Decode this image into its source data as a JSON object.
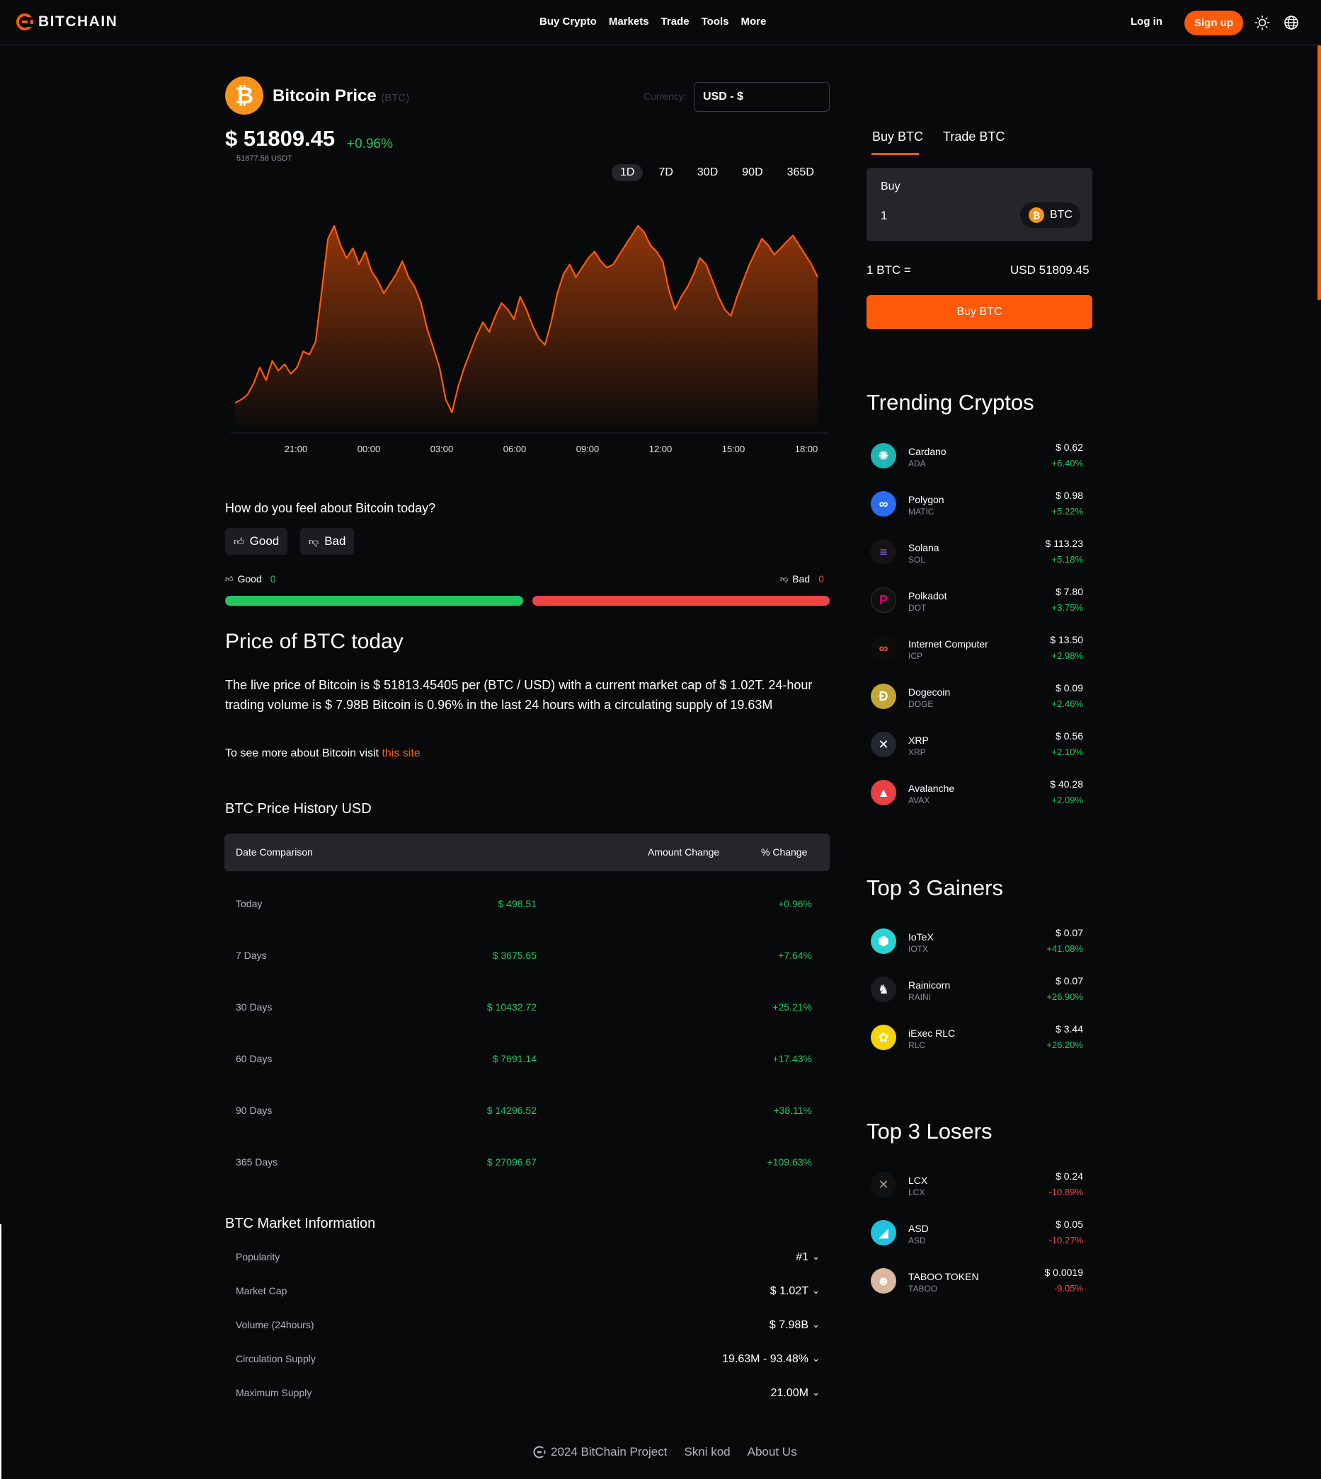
{
  "header": {
    "brand": "BITCHAIN",
    "nav": [
      "Buy Crypto",
      "Markets",
      "Trade",
      "Tools",
      "More"
    ],
    "login": "Log in",
    "signup": "Sign up"
  },
  "coin": {
    "name": "Bitcoin Price",
    "symbol_tag": "(BTC)",
    "currency_label": "Currency:",
    "currency_value": "USD - $",
    "price": "$ 51809.45",
    "change": "+0.96%",
    "price_usdt": "51877.58 USDT",
    "ranges": [
      "1D",
      "7D",
      "30D",
      "90D",
      "365D"
    ],
    "active_range": "1D"
  },
  "chart_data": {
    "type": "area",
    "x_ticks": [
      "21:00",
      "00:00",
      "03:00",
      "06:00",
      "09:00",
      "12:00",
      "15:00",
      "18:00"
    ],
    "series": [
      {
        "values": [
          50950,
          50960,
          50975,
          51010,
          51060,
          51020,
          51080,
          51050,
          51070,
          51040,
          51060,
          51110,
          51100,
          51140,
          51300,
          51460,
          51500,
          51440,
          51400,
          51430,
          51380,
          51420,
          51360,
          51330,
          51290,
          51320,
          51350,
          51390,
          51340,
          51310,
          51260,
          51180,
          51120,
          51060,
          50960,
          50920,
          51000,
          51060,
          51110,
          51160,
          51200,
          51170,
          51220,
          51260,
          51240,
          51210,
          51280,
          51240,
          51190,
          51150,
          51130,
          51200,
          51290,
          51350,
          51380,
          51340,
          51370,
          51400,
          51420,
          51390,
          51370,
          51380,
          51410,
          51440,
          51470,
          51500,
          51480,
          51440,
          51420,
          51390,
          51300,
          51240,
          51280,
          51310,
          51350,
          51400,
          51380,
          51330,
          51280,
          51240,
          51220,
          51280,
          51330,
          51380,
          51420,
          51460,
          51440,
          51410,
          51430,
          51450,
          51470,
          51440,
          51410,
          51380,
          51340
        ]
      }
    ],
    "ylim": [
      50900,
      51520
    ]
  },
  "sentiment": {
    "question": "How do you feel about Bitcoin today?",
    "good_label": "Good",
    "bad_label": "Bad",
    "good_count": "0",
    "bad_count": "0"
  },
  "about": {
    "heading": "Price of BTC today",
    "paragraph": "The live price of Bitcoin is $ 51813.45405 per (BTC / USD) with a current market cap of $ 1.02T. 24-hour trading volume is $ 7.98B Bitcoin is 0.96% in the last 24 hours with a circulating supply of 19.63M",
    "more_prefix": "To see more about Bitcoin visit",
    "more_link": "this site"
  },
  "history": {
    "heading": "BTC Price History USD",
    "columns": [
      "Date Comparison",
      "Amount Change",
      "% Change"
    ],
    "rows": [
      {
        "label": "Today",
        "amount": "$ 498.51",
        "pct": "+0.96%"
      },
      {
        "label": "7 Days",
        "amount": "$ 3675.65",
        "pct": "+7.64%"
      },
      {
        "label": "30 Days",
        "amount": "$ 10432.72",
        "pct": "+25.21%"
      },
      {
        "label": "60 Days",
        "amount": "$ 7691.14",
        "pct": "+17.43%"
      },
      {
        "label": "90 Days",
        "amount": "$ 14296.52",
        "pct": "+38.11%"
      },
      {
        "label": "365 Days",
        "amount": "$ 27096.67",
        "pct": "+109.63%"
      }
    ]
  },
  "market": {
    "heading": "BTC Market Information",
    "rows": [
      {
        "label": "Popularity",
        "value": "#1"
      },
      {
        "label": "Market Cap",
        "value": "$ 1.02T"
      },
      {
        "label": "Volume (24hours)",
        "value": "$ 7.98B"
      },
      {
        "label": "Circulation Supply",
        "value": "19.63M - 93.48%"
      },
      {
        "label": "Maximum Supply",
        "value": "21.00M"
      }
    ]
  },
  "footer": {
    "copyright": "2024 BitChain Project",
    "link1": "Skni kod",
    "link2": "About Us"
  },
  "trade": {
    "tabs": [
      "Buy BTC",
      "Trade BTC"
    ],
    "buy_label": "Buy",
    "amount": "1",
    "token": "BTC",
    "rate_left": "1 BTC =",
    "rate_right": "USD 51809.45",
    "button": "Buy BTC"
  },
  "trending": {
    "heading": "Trending Cryptos",
    "items": [
      {
        "name": "Cardano",
        "symbol": "ADA",
        "price": "$ 0.62",
        "change": "+6.40%",
        "icon": "cardano-icon",
        "color": "#1fb5b5"
      },
      {
        "name": "Polygon",
        "symbol": "MATIC",
        "price": "$ 0.98",
        "change": "+5.22%",
        "icon": "polygon-icon",
        "color": "#2b6def"
      },
      {
        "name": "Solana",
        "symbol": "SOL",
        "price": "$ 113.23",
        "change": "+5.18%",
        "icon": "solana-icon",
        "color": "#141414"
      },
      {
        "name": "Polkadot",
        "symbol": "DOT",
        "price": "$ 7.80",
        "change": "+3.75%",
        "icon": "polkadot-icon",
        "color": "#111111"
      },
      {
        "name": "Internet Computer",
        "symbol": "ICP",
        "price": "$ 13.50",
        "change": "+2.98%",
        "icon": "icp-icon",
        "color": "#111111"
      },
      {
        "name": "Dogecoin",
        "symbol": "DOGE",
        "price": "$ 0.09",
        "change": "+2.46%",
        "icon": "dogecoin-icon",
        "color": "#c2a633"
      },
      {
        "name": "XRP",
        "symbol": "XRP",
        "price": "$ 0.56",
        "change": "+2.10%",
        "icon": "xrp-icon",
        "color": "#23272e"
      },
      {
        "name": "Avalanche",
        "symbol": "AVAX",
        "price": "$ 40.28",
        "change": "+2.09%",
        "icon": "avalanche-icon",
        "color": "#e84142"
      }
    ]
  },
  "gainers": {
    "heading": "Top 3 Gainers",
    "items": [
      {
        "name": "IoTeX",
        "symbol": "IOTX",
        "price": "$ 0.07",
        "change": "+41.08%",
        "icon": "iotex-icon",
        "color": "#2ad4d4"
      },
      {
        "name": "Rainicorn",
        "symbol": "RAINI",
        "price": "$ 0.07",
        "change": "+26.90%",
        "icon": "rainicorn-icon",
        "color": "#1b1b22"
      },
      {
        "name": "iExec RLC",
        "symbol": "RLC",
        "price": "$ 3.44",
        "change": "+26.20%",
        "icon": "iexec-icon",
        "color": "#f5d50a"
      }
    ]
  },
  "losers": {
    "heading": "Top 3 Losers",
    "items": [
      {
        "name": "LCX",
        "symbol": "LCX",
        "price": "$ 0.24",
        "change": "-10.89%",
        "icon": "lcx-icon",
        "color": "#111111"
      },
      {
        "name": "ASD",
        "symbol": "ASD",
        "price": "$ 0.05",
        "change": "-10.27%",
        "icon": "asd-icon",
        "color": "#1ec3df"
      },
      {
        "name": "TABOO TOKEN",
        "symbol": "TABOO",
        "price": "$ 0.0019",
        "change": "-9.05%",
        "icon": "taboo-icon",
        "color": "#d9b8a0"
      }
    ]
  },
  "colors": {
    "accent": "#ff5a0a",
    "positive": "#22c55e",
    "negative": "#ef4444",
    "background": "#08090b",
    "panel": "#24262b"
  }
}
